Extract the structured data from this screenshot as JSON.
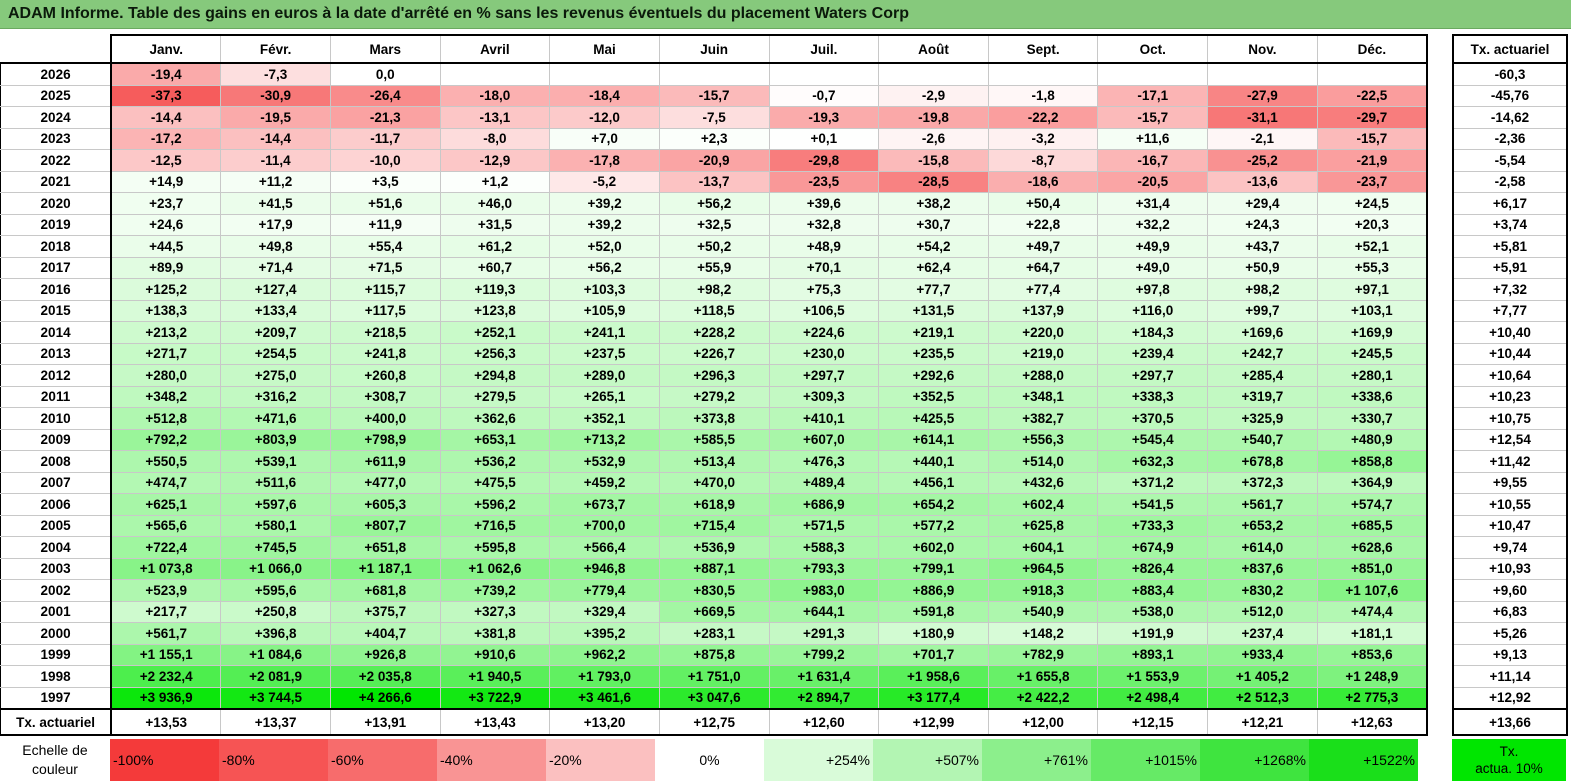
{
  "title": "ADAM Informe. Table des gains en euros à la date d'arrêté en % sans les revenus éventuels du placement Waters Corp",
  "months": [
    "Janv.",
    "Févr.",
    "Mars",
    "Avril",
    "Mai",
    "Juin",
    "Juil.",
    "Août",
    "Sept.",
    "Oct.",
    "Nov.",
    "Déc."
  ],
  "rate_header": "Tx. actuariel",
  "rows": [
    {
      "year": "2026",
      "values": [
        "-19,4",
        "-7,3",
        "0,0",
        "",
        "",
        "",
        "",
        "",
        "",
        "",
        "",
        ""
      ],
      "rate": "-60,3"
    },
    {
      "year": "2025",
      "values": [
        "-37,3",
        "-30,9",
        "-26,4",
        "-18,0",
        "-18,4",
        "-15,7",
        "-0,7",
        "-2,9",
        "-1,8",
        "-17,1",
        "-27,9",
        "-22,5"
      ],
      "rate": "-45,76"
    },
    {
      "year": "2024",
      "values": [
        "-14,4",
        "-19,5",
        "-21,3",
        "-13,1",
        "-12,0",
        "-7,5",
        "-19,3",
        "-19,8",
        "-22,2",
        "-15,7",
        "-31,1",
        "-29,7"
      ],
      "rate": "-14,62"
    },
    {
      "year": "2023",
      "values": [
        "-17,2",
        "-14,4",
        "-11,7",
        "-8,0",
        "+7,0",
        "+2,3",
        "+0,1",
        "-2,6",
        "-3,2",
        "+11,6",
        "-2,1",
        "-15,7"
      ],
      "rate": "-2,36"
    },
    {
      "year": "2022",
      "values": [
        "-12,5",
        "-11,4",
        "-10,0",
        "-12,9",
        "-17,8",
        "-20,9",
        "-29,8",
        "-15,8",
        "-8,7",
        "-16,7",
        "-25,2",
        "-21,9"
      ],
      "rate": "-5,54"
    },
    {
      "year": "2021",
      "values": [
        "+14,9",
        "+11,2",
        "+3,5",
        "+1,2",
        "-5,2",
        "-13,7",
        "-23,5",
        "-28,5",
        "-18,6",
        "-20,5",
        "-13,6",
        "-23,7"
      ],
      "rate": "-2,58"
    },
    {
      "year": "2020",
      "values": [
        "+23,7",
        "+41,5",
        "+51,6",
        "+46,0",
        "+39,2",
        "+56,2",
        "+39,6",
        "+38,2",
        "+50,4",
        "+31,4",
        "+29,4",
        "+24,5"
      ],
      "rate": "+6,17"
    },
    {
      "year": "2019",
      "values": [
        "+24,6",
        "+17,9",
        "+11,9",
        "+31,5",
        "+39,2",
        "+32,5",
        "+32,8",
        "+30,7",
        "+22,8",
        "+32,2",
        "+24,3",
        "+20,3"
      ],
      "rate": "+3,74"
    },
    {
      "year": "2018",
      "values": [
        "+44,5",
        "+49,8",
        "+55,4",
        "+61,2",
        "+52,0",
        "+50,2",
        "+48,9",
        "+54,2",
        "+49,7",
        "+49,9",
        "+43,7",
        "+52,1"
      ],
      "rate": "+5,81"
    },
    {
      "year": "2017",
      "values": [
        "+89,9",
        "+71,4",
        "+71,5",
        "+60,7",
        "+56,2",
        "+55,9",
        "+70,1",
        "+62,4",
        "+64,7",
        "+49,0",
        "+50,9",
        "+55,3"
      ],
      "rate": "+5,91"
    },
    {
      "year": "2016",
      "values": [
        "+125,2",
        "+127,4",
        "+115,7",
        "+119,3",
        "+103,3",
        "+98,2",
        "+75,3",
        "+77,7",
        "+77,4",
        "+97,8",
        "+98,2",
        "+97,1"
      ],
      "rate": "+7,32"
    },
    {
      "year": "2015",
      "values": [
        "+138,3",
        "+133,4",
        "+117,5",
        "+123,8",
        "+105,9",
        "+118,5",
        "+106,5",
        "+131,5",
        "+137,9",
        "+116,0",
        "+99,7",
        "+103,1"
      ],
      "rate": "+7,77"
    },
    {
      "year": "2014",
      "values": [
        "+213,2",
        "+209,7",
        "+218,5",
        "+252,1",
        "+241,1",
        "+228,2",
        "+224,6",
        "+219,1",
        "+220,0",
        "+184,3",
        "+169,6",
        "+169,9"
      ],
      "rate": "+10,40"
    },
    {
      "year": "2013",
      "values": [
        "+271,7",
        "+254,5",
        "+241,8",
        "+256,3",
        "+237,5",
        "+226,7",
        "+230,0",
        "+235,5",
        "+219,0",
        "+239,4",
        "+242,7",
        "+245,5"
      ],
      "rate": "+10,44"
    },
    {
      "year": "2012",
      "values": [
        "+280,0",
        "+275,0",
        "+260,8",
        "+294,8",
        "+289,0",
        "+296,3",
        "+297,7",
        "+292,6",
        "+288,0",
        "+297,7",
        "+285,4",
        "+280,1"
      ],
      "rate": "+10,64"
    },
    {
      "year": "2011",
      "values": [
        "+348,2",
        "+316,2",
        "+308,7",
        "+279,5",
        "+265,1",
        "+279,2",
        "+309,3",
        "+352,5",
        "+348,1",
        "+338,3",
        "+319,7",
        "+338,6"
      ],
      "rate": "+10,23"
    },
    {
      "year": "2010",
      "values": [
        "+512,8",
        "+471,6",
        "+400,0",
        "+362,6",
        "+352,1",
        "+373,8",
        "+410,1",
        "+425,5",
        "+382,7",
        "+370,5",
        "+325,9",
        "+330,7"
      ],
      "rate": "+10,75"
    },
    {
      "year": "2009",
      "values": [
        "+792,2",
        "+803,9",
        "+798,9",
        "+653,1",
        "+713,2",
        "+585,5",
        "+607,0",
        "+614,1",
        "+556,3",
        "+545,4",
        "+540,7",
        "+480,9"
      ],
      "rate": "+12,54"
    },
    {
      "year": "2008",
      "values": [
        "+550,5",
        "+539,1",
        "+611,9",
        "+536,2",
        "+532,9",
        "+513,4",
        "+476,3",
        "+440,1",
        "+514,0",
        "+632,3",
        "+678,8",
        "+858,8"
      ],
      "rate": "+11,42"
    },
    {
      "year": "2007",
      "values": [
        "+474,7",
        "+511,6",
        "+477,0",
        "+475,5",
        "+459,2",
        "+470,0",
        "+489,4",
        "+456,1",
        "+432,6",
        "+371,2",
        "+372,3",
        "+364,9"
      ],
      "rate": "+9,55"
    },
    {
      "year": "2006",
      "values": [
        "+625,1",
        "+597,6",
        "+605,3",
        "+596,2",
        "+673,7",
        "+618,9",
        "+686,9",
        "+654,2",
        "+602,4",
        "+541,5",
        "+561,7",
        "+574,7"
      ],
      "rate": "+10,55"
    },
    {
      "year": "2005",
      "values": [
        "+565,6",
        "+580,1",
        "+807,7",
        "+716,5",
        "+700,0",
        "+715,4",
        "+571,5",
        "+577,2",
        "+625,8",
        "+733,3",
        "+653,2",
        "+685,5"
      ],
      "rate": "+10,47"
    },
    {
      "year": "2004",
      "values": [
        "+722,4",
        "+745,5",
        "+651,8",
        "+595,8",
        "+566,4",
        "+536,9",
        "+588,3",
        "+602,0",
        "+604,1",
        "+674,9",
        "+614,0",
        "+628,6"
      ],
      "rate": "+9,74"
    },
    {
      "year": "2003",
      "values": [
        "+1 073,8",
        "+1 066,0",
        "+1 187,1",
        "+1 062,6",
        "+946,8",
        "+887,1",
        "+793,3",
        "+799,1",
        "+964,5",
        "+826,4",
        "+837,6",
        "+851,0"
      ],
      "rate": "+10,93"
    },
    {
      "year": "2002",
      "values": [
        "+523,9",
        "+595,6",
        "+681,8",
        "+739,2",
        "+779,4",
        "+830,5",
        "+983,0",
        "+886,9",
        "+918,3",
        "+883,4",
        "+830,2",
        "+1 107,6"
      ],
      "rate": "+9,60"
    },
    {
      "year": "2001",
      "values": [
        "+217,7",
        "+250,8",
        "+375,7",
        "+327,3",
        "+329,4",
        "+669,5",
        "+644,1",
        "+591,8",
        "+540,9",
        "+538,0",
        "+512,0",
        "+474,4"
      ],
      "rate": "+6,83"
    },
    {
      "year": "2000",
      "values": [
        "+561,7",
        "+396,8",
        "+404,7",
        "+381,8",
        "+395,2",
        "+283,1",
        "+291,3",
        "+180,9",
        "+148,2",
        "+191,9",
        "+237,4",
        "+181,1"
      ],
      "rate": "+5,26"
    },
    {
      "year": "1999",
      "values": [
        "+1 155,1",
        "+1 084,6",
        "+926,8",
        "+910,6",
        "+962,2",
        "+875,8",
        "+799,2",
        "+701,7",
        "+782,9",
        "+893,1",
        "+933,4",
        "+853,6"
      ],
      "rate": "+9,13"
    },
    {
      "year": "1998",
      "values": [
        "+2 232,4",
        "+2 081,9",
        "+2 035,8",
        "+1 940,5",
        "+1 793,0",
        "+1 751,0",
        "+1 631,4",
        "+1 958,6",
        "+1 655,8",
        "+1 553,9",
        "+1 405,2",
        "+1 248,9"
      ],
      "rate": "+11,14"
    },
    {
      "year": "1997",
      "values": [
        "+3 936,9",
        "+3 744,5",
        "+4 266,6",
        "+3 722,9",
        "+3 461,6",
        "+3 047,6",
        "+2 894,7",
        "+3 177,4",
        "+2 422,2",
        "+2 498,4",
        "+2 512,3",
        "+2 775,3"
      ],
      "rate": "+12,92"
    }
  ],
  "footer": {
    "label": "Tx. actuariel",
    "values": [
      "+13,53",
      "+13,37",
      "+13,91",
      "+13,43",
      "+13,20",
      "+12,75",
      "+12,60",
      "+12,99",
      "+12,00",
      "+12,15",
      "+12,21",
      "+12,63"
    ],
    "rate": "+13,66"
  },
  "scale": {
    "label_line1": "Echelle de",
    "label_line2": "couleur",
    "items": [
      {
        "text": "-100%",
        "color": "#f43a3a",
        "kind": "neg"
      },
      {
        "text": "-80%",
        "color": "#f65454",
        "kind": "neg"
      },
      {
        "text": "-60%",
        "color": "#f76c6c",
        "kind": "neg"
      },
      {
        "text": "-40%",
        "color": "#f99494",
        "kind": "neg"
      },
      {
        "text": "-20%",
        "color": "#fbc0c0",
        "kind": "neg"
      },
      {
        "text": "0%",
        "color": "#ffffff",
        "kind": "zero"
      },
      {
        "text": "+254%",
        "color": "#d9fbd9",
        "kind": "pos"
      },
      {
        "text": "+507%",
        "color": "#b3f5b3",
        "kind": "pos"
      },
      {
        "text": "+761%",
        "color": "#8cef8c",
        "kind": "pos"
      },
      {
        "text": "+1015%",
        "color": "#66ea66",
        "kind": "pos"
      },
      {
        "text": "+1268%",
        "color": "#3fe43f",
        "kind": "pos"
      },
      {
        "text": "+1522%",
        "color": "#1adf1a",
        "kind": "pos"
      }
    ],
    "rate_line1": "Tx.",
    "rate_line2": "actua. 10%",
    "rate_color": "#00e600"
  },
  "colors": {
    "title_bar": "#86c97c",
    "negative_max": "#f43a3a",
    "positive_max": "#00e600"
  }
}
